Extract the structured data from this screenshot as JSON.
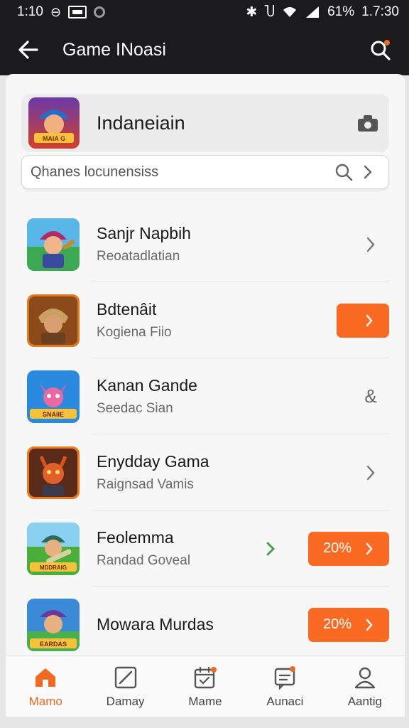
{
  "status_bar": {
    "time_left": "1:10",
    "time_right": "1.7:30",
    "battery": "61%"
  },
  "app_bar": {
    "title": "Game INoasi",
    "back_icon": "arrow-left-icon",
    "search_icon": "search-icon"
  },
  "hero": {
    "title": "Indaneiain",
    "thumb_text": "MAIA G",
    "action_icon": "camera-icon"
  },
  "search": {
    "placeholder": "Qhanes locunensiss",
    "search_icon": "search-icon",
    "chevron_icon": "chevron-right-icon"
  },
  "games": [
    {
      "name": "Sanjr Napbih",
      "subtitle": "Reoatadlatian",
      "action": "chevron",
      "thumb_text": ""
    },
    {
      "name": "Bdtenâit",
      "subtitle": "Kogiena Fiio",
      "action": "button",
      "button_label": "",
      "thumb_text": ""
    },
    {
      "name": "Kanan Gande",
      "subtitle": "Seedac Sian",
      "action": "symbol",
      "symbol": "&",
      "thumb_text": "SNAIIE"
    },
    {
      "name": "Enydday Gama",
      "subtitle": "Raignsad Vamis",
      "action": "chevron",
      "thumb_text": ""
    },
    {
      "name": "Feolemma",
      "subtitle": "Randad Goveal",
      "action": "button",
      "button_label": "20%",
      "thumb_text": "MDDRAIG"
    },
    {
      "name": "Mowara Murdas",
      "subtitle": "",
      "action": "button",
      "button_label": "20%",
      "thumb_text": "EARDAS"
    }
  ],
  "bottom_nav": [
    {
      "label": "Mamo",
      "icon": "home-icon",
      "active": true
    },
    {
      "label": "Damay",
      "icon": "edit-icon",
      "active": false
    },
    {
      "label": "Mame",
      "icon": "calendar-icon",
      "active": false
    },
    {
      "label": "Aunaci",
      "icon": "chat-icon",
      "active": false
    },
    {
      "label": "Aantig",
      "icon": "profile-icon",
      "active": false
    }
  ],
  "colors": {
    "accent": "#fb6a22",
    "bar": "#1b1b1d",
    "green": "#3aa34a"
  }
}
